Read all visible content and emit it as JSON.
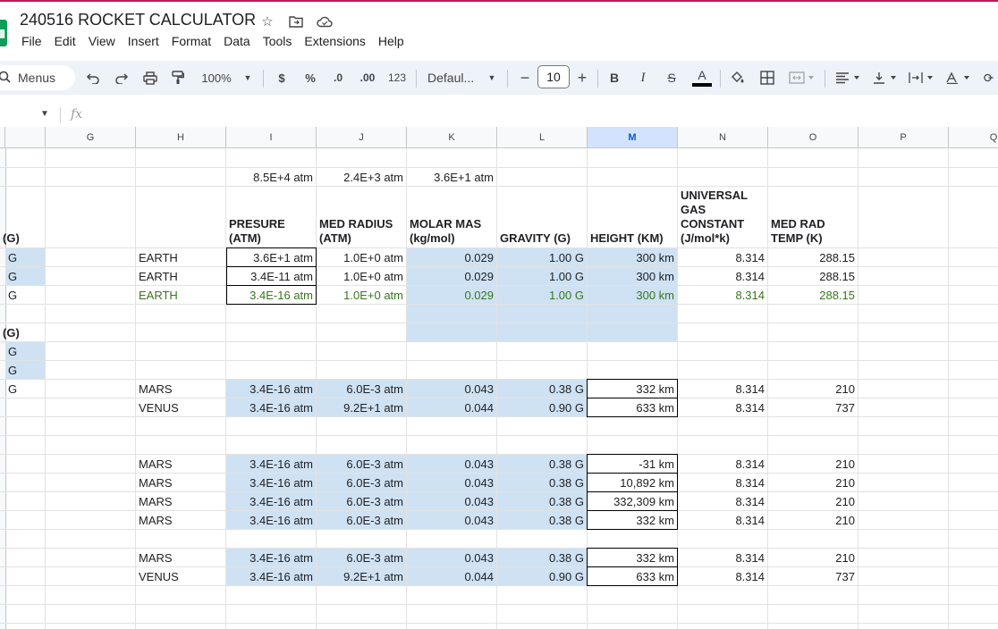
{
  "doc": {
    "title": "240516 ROCKET CALCULATOR",
    "menus": [
      "File",
      "Edit",
      "View",
      "Insert",
      "Format",
      "Data",
      "Tools",
      "Extensions",
      "Help"
    ]
  },
  "toolbar": {
    "menus_label": "Menus",
    "zoom": "100%",
    "currency": "$",
    "percent": "%",
    "dec_less": ".0",
    "dec_more": ".00",
    "number_format": "123",
    "font": "Defaul...",
    "font_size": "10",
    "bold": "B",
    "italic": "I",
    "strike": "S",
    "text_color": "A"
  },
  "formula_bar": {
    "fx": "fx"
  },
  "columns": [
    "G",
    "H",
    "I",
    "J",
    "K",
    "L",
    "M",
    "N",
    "O",
    "P",
    "Q"
  ],
  "selected_column": "M",
  "colors": {
    "highlight": "#cfe2f3",
    "green_text": "#38761d",
    "accent": "#0b57d0"
  },
  "sheet": {
    "top_values": {
      "I": "8.5E+4 atm",
      "J": "2.4E+3 atm",
      "K": "3.6E+1 atm"
    },
    "headers": {
      "F": "(G)",
      "I": "PRESURE (ATM)",
      "J": "MED RADIUS (ATM)",
      "K": "MOLAR MAS (kg/mol)",
      "L": "GRAVITY (G)",
      "M": "HEIGHT (KM)",
      "N": "UNIVERSAL GAS CONSTANT (J/mol*k)",
      "O": "MED RAD TEMP (K)"
    },
    "f_label2": "(G)",
    "g": "G",
    "earth_rows": [
      {
        "name": "EARTH",
        "p": "3.6E+1 atm",
        "r": "1.0E+0 atm",
        "k": "0.029",
        "g": "1.00 G",
        "h": "300 km",
        "n": "8.314",
        "t": "288.15"
      },
      {
        "name": "EARTH",
        "p": "3.4E-11 atm",
        "r": "1.0E+0 atm",
        "k": "0.029",
        "g": "1.00 G",
        "h": "300 km",
        "n": "8.314",
        "t": "288.15"
      },
      {
        "name": "EARTH",
        "p": "3.4E-16 atm",
        "r": "1.0E+0 atm",
        "k": "0.029",
        "g": "1.00 G",
        "h": "300 km",
        "n": "8.314",
        "t": "288.15"
      }
    ],
    "group2": [
      {
        "name": "MARS",
        "p": "3.4E-16 atm",
        "r": "6.0E-3 atm",
        "k": "0.043",
        "g": "0.38 G",
        "h": "332 km",
        "n": "8.314",
        "t": "210"
      },
      {
        "name": "VENUS",
        "p": "3.4E-16 atm",
        "r": "9.2E+1 atm",
        "k": "0.044",
        "g": "0.90 G",
        "h": "633 km",
        "n": "8.314",
        "t": "737"
      }
    ],
    "group3": [
      {
        "name": "MARS",
        "p": "3.4E-16 atm",
        "r": "6.0E-3 atm",
        "k": "0.043",
        "g": "0.38 G",
        "h": "-31 km",
        "n": "8.314",
        "t": "210"
      },
      {
        "name": "MARS",
        "p": "3.4E-16 atm",
        "r": "6.0E-3 atm",
        "k": "0.043",
        "g": "0.38 G",
        "h": "10,892 km",
        "n": "8.314",
        "t": "210"
      },
      {
        "name": "MARS",
        "p": "3.4E-16 atm",
        "r": "6.0E-3 atm",
        "k": "0.043",
        "g": "0.38 G",
        "h": "332,309 km",
        "n": "8.314",
        "t": "210"
      },
      {
        "name": "MARS",
        "p": "3.4E-16 atm",
        "r": "6.0E-3 atm",
        "k": "0.043",
        "g": "0.38 G",
        "h": "332 km",
        "n": "8.314",
        "t": "210"
      }
    ],
    "group4": [
      {
        "name": "MARS",
        "p": "3.4E-16 atm",
        "r": "6.0E-3 atm",
        "k": "0.043",
        "g": "0.38 G",
        "h": "332 km",
        "n": "8.314",
        "t": "210"
      },
      {
        "name": "VENUS",
        "p": "3.4E-16 atm",
        "r": "9.2E+1 atm",
        "k": "0.044",
        "g": "0.90 G",
        "h": "633 km",
        "n": "8.314",
        "t": "737"
      }
    ]
  }
}
